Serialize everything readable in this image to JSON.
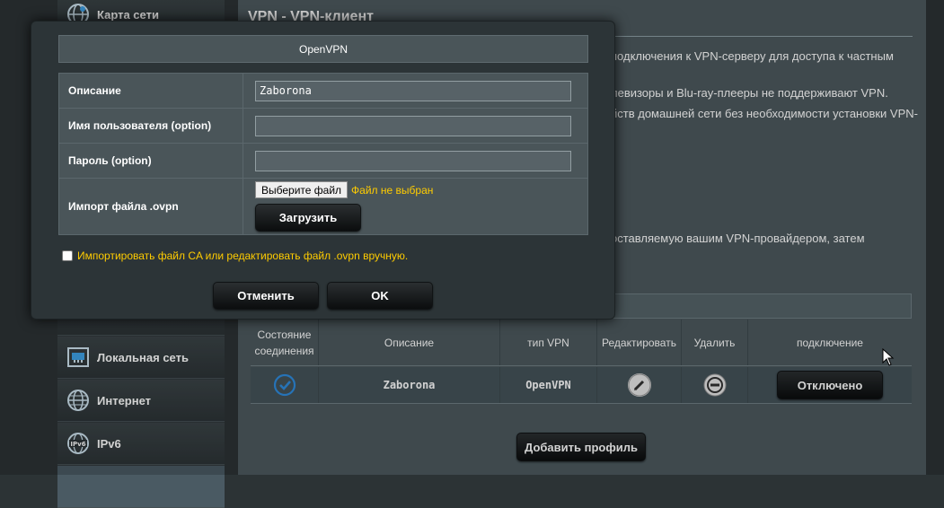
{
  "sidebar": {
    "items": [
      {
        "label": "Карта сети",
        "icon": "globe-map-icon"
      },
      {
        "label": "",
        "icon": ""
      },
      {
        "label": "Локальная сеть",
        "icon": "lan-icon"
      },
      {
        "label": "Интернет",
        "icon": "globe-icon"
      },
      {
        "label": "IPv6",
        "icon": "ipv6-globe-icon"
      },
      {
        "label": "",
        "icon": ""
      }
    ]
  },
  "main": {
    "title": "VPN - VPN-клиент",
    "description_lines": [
      "подключения к VPN-серверу для доступа к частным",
      "левизоры и Blu-ray-плееры не поддерживают VPN.",
      "йств домашней сети без необходимости установки VPN-",
      "оставляемую вашим VPN-провайдером, затем"
    ],
    "table": {
      "columns": [
        "Состояние соединения",
        "Описание",
        "тип VPN",
        "Редактировать",
        "Удалить",
        "подключение"
      ],
      "rows": [
        {
          "status_icon": "check-circle-icon",
          "description": "Zaborona",
          "vpn_type": "OpenVPN",
          "edit_icon": "edit-pencil-icon",
          "delete_icon": "delete-minus-icon",
          "connection_button": "Отключено"
        }
      ]
    },
    "add_profile_button": "Добавить профиль"
  },
  "modal": {
    "title": "OpenVPN",
    "fields": {
      "description_label": "Описание",
      "description_value": "Zaborona",
      "username_label": "Имя пользователя (option)",
      "username_value": "",
      "password_label": "Пароль (option)",
      "password_value": "",
      "import_label": "Импорт файла .ovpn",
      "choose_file_button": "Выберите файл",
      "file_status": "Файл не выбран",
      "upload_button": "Загрузить"
    },
    "ca_checkbox_label": "Импортировать файл CA или редактировать файл .ovpn вручную.",
    "ca_checkbox_checked": false,
    "cancel_button": "Отменить",
    "ok_button": "OK"
  },
  "colors": {
    "accent_yellow": "#ffcc00",
    "check_blue": "#2f8de0"
  }
}
